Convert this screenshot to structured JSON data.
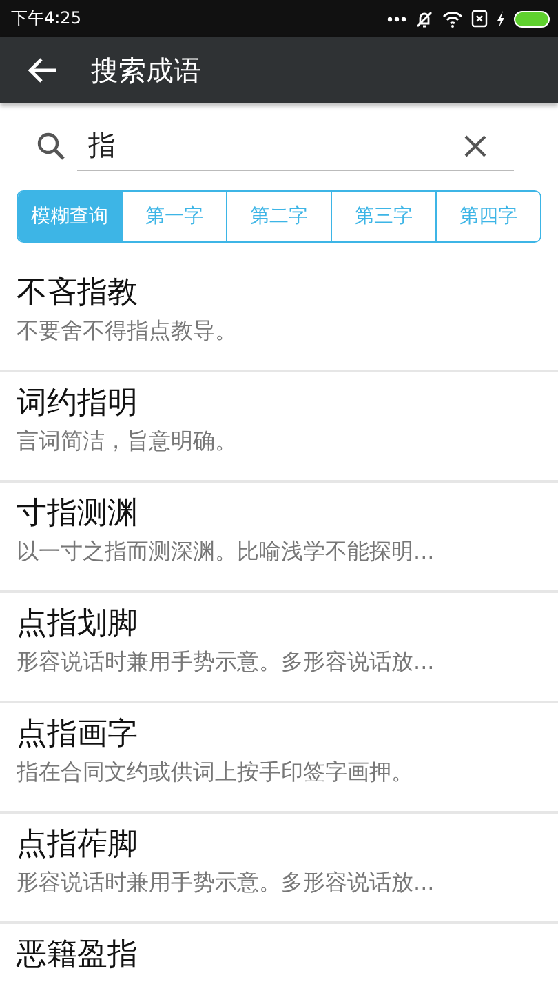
{
  "status_bar": {
    "time": "下午4:25"
  },
  "app_bar": {
    "title": "搜索成语"
  },
  "search": {
    "value": "指"
  },
  "tabs": [
    {
      "label": "模糊查询",
      "selected": true
    },
    {
      "label": "第一字",
      "selected": false
    },
    {
      "label": "第二字",
      "selected": false
    },
    {
      "label": "第三字",
      "selected": false
    },
    {
      "label": "第四字",
      "selected": false
    }
  ],
  "results": [
    {
      "idiom": "不吝指教",
      "meaning": "不要舍不得指点教导。"
    },
    {
      "idiom": "词约指明",
      "meaning": "言词简洁，旨意明确。"
    },
    {
      "idiom": "寸指测渊",
      "meaning": "以一寸之指而测深渊。比喻浅学不能探明..."
    },
    {
      "idiom": "点指划脚",
      "meaning": "形容说话时兼用手势示意。多形容说话放..."
    },
    {
      "idiom": "点指画字",
      "meaning": "指在合同文约或供词上按手印签字画押。"
    },
    {
      "idiom": "点指莋脚",
      "meaning": "形容说话时兼用手势示意。多形容说话放..."
    },
    {
      "idiom": "恶籍盈指"
    }
  ]
}
